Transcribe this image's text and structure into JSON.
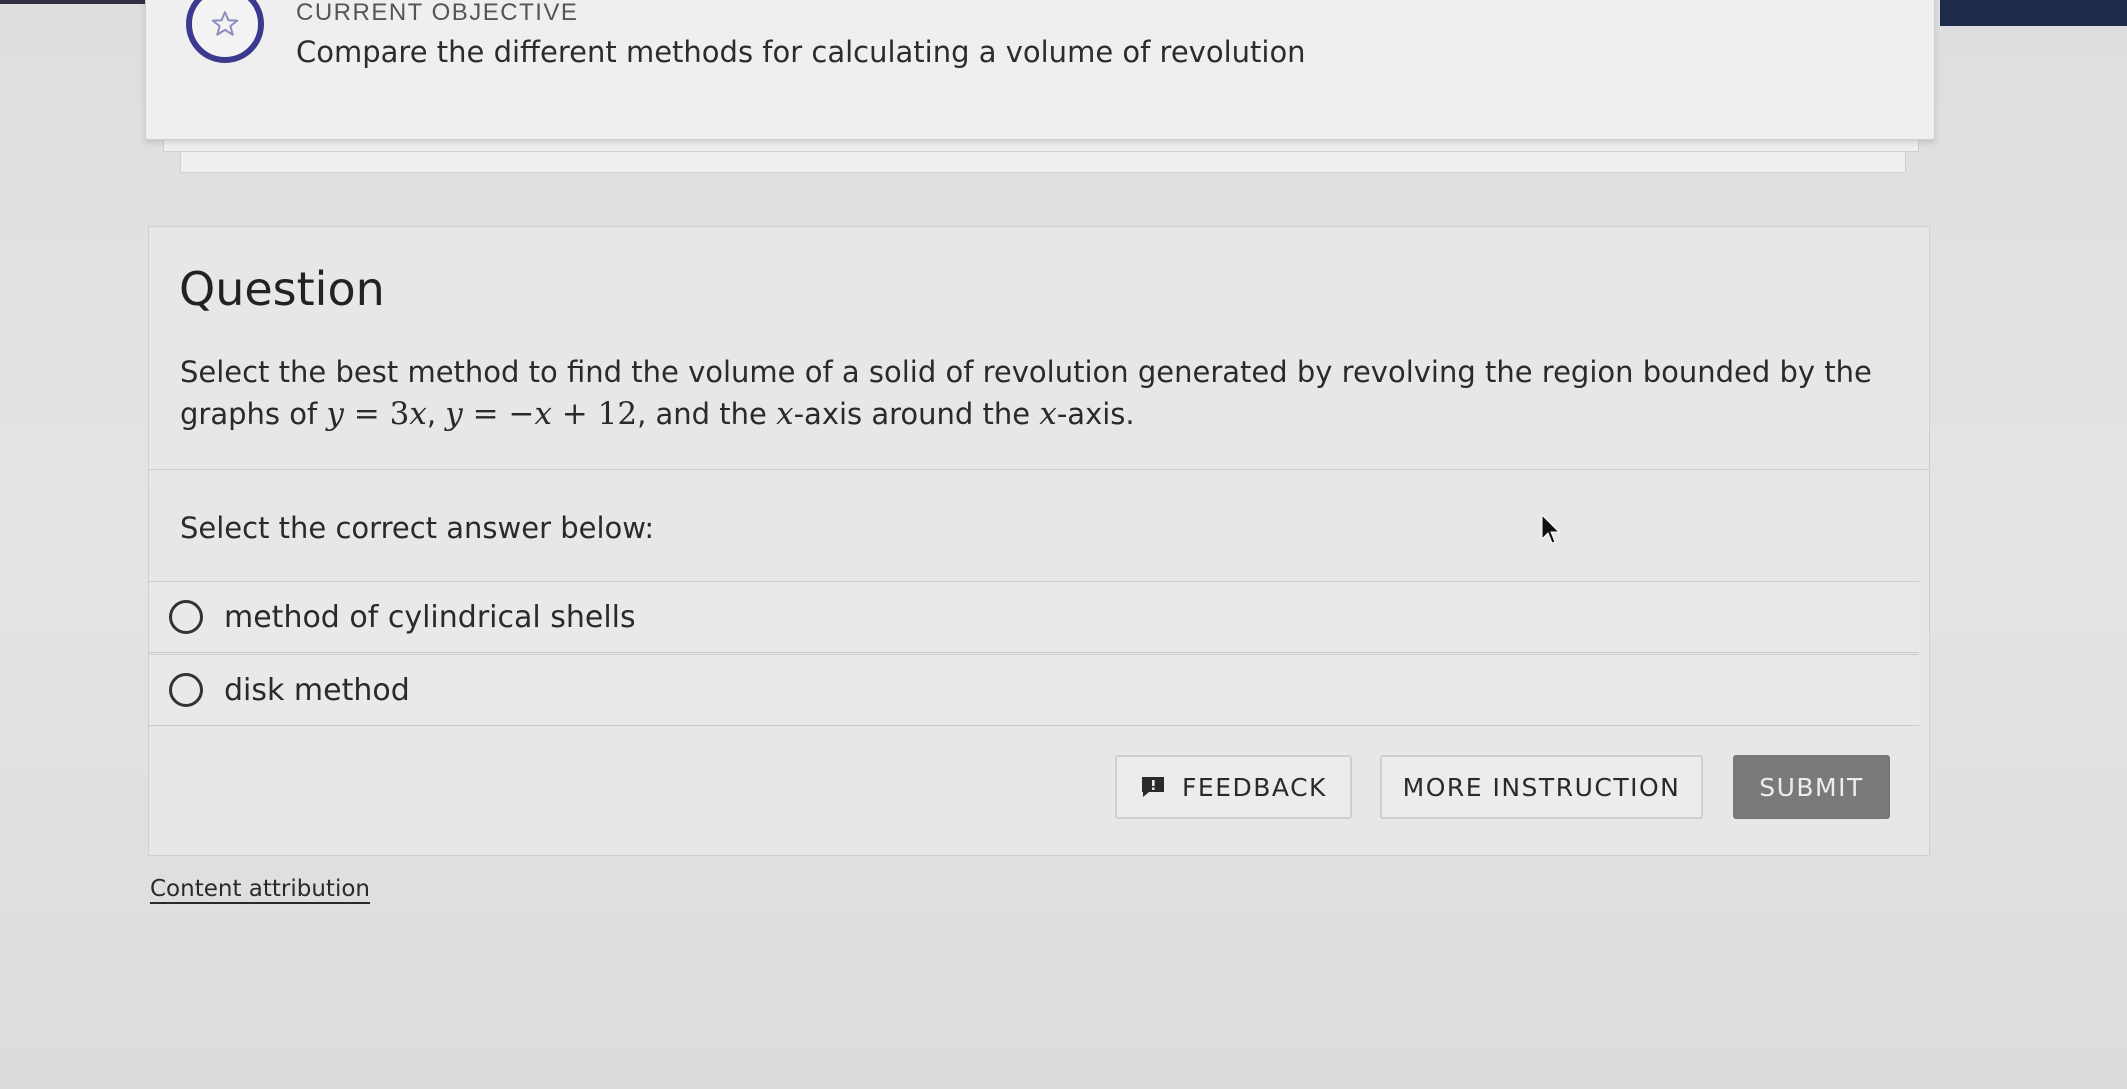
{
  "objective": {
    "label": "CURRENT OBJECTIVE",
    "text": "Compare the different methods for calculating a volume of revolution",
    "icon": "star-icon"
  },
  "question": {
    "title": "Question",
    "text_prefix": "Select the best method to find the volume of a solid of revolution generated by revolving the region bounded by the graphs of ",
    "eq1_lhs": "y",
    "eq1_eq": " = ",
    "eq1_num": "3",
    "eq1_var": "x",
    "comma1": ", ",
    "eq2_lhs": "y",
    "eq2_eq": " = −",
    "eq2_var": "x",
    "eq2_plus": " + 12",
    "text_mid": ", and the ",
    "axis1": "x",
    "text_mid2": "-axis around the ",
    "axis2": "x",
    "text_end": "-axis."
  },
  "answers": {
    "prompt": "Select the correct answer below:",
    "options": [
      {
        "label": "method of cylindrical shells"
      },
      {
        "label": "disk method"
      }
    ]
  },
  "actions": {
    "feedback_label": "FEEDBACK",
    "more_instruction_label": "MORE INSTRUCTION",
    "submit_label": "SUBMIT"
  },
  "footer": {
    "attribution_label": "Content attribution"
  },
  "colors": {
    "accent_ring": "#3b3a8f",
    "submit_bg": "#7a7a7a",
    "background": "#e2e2e2"
  }
}
